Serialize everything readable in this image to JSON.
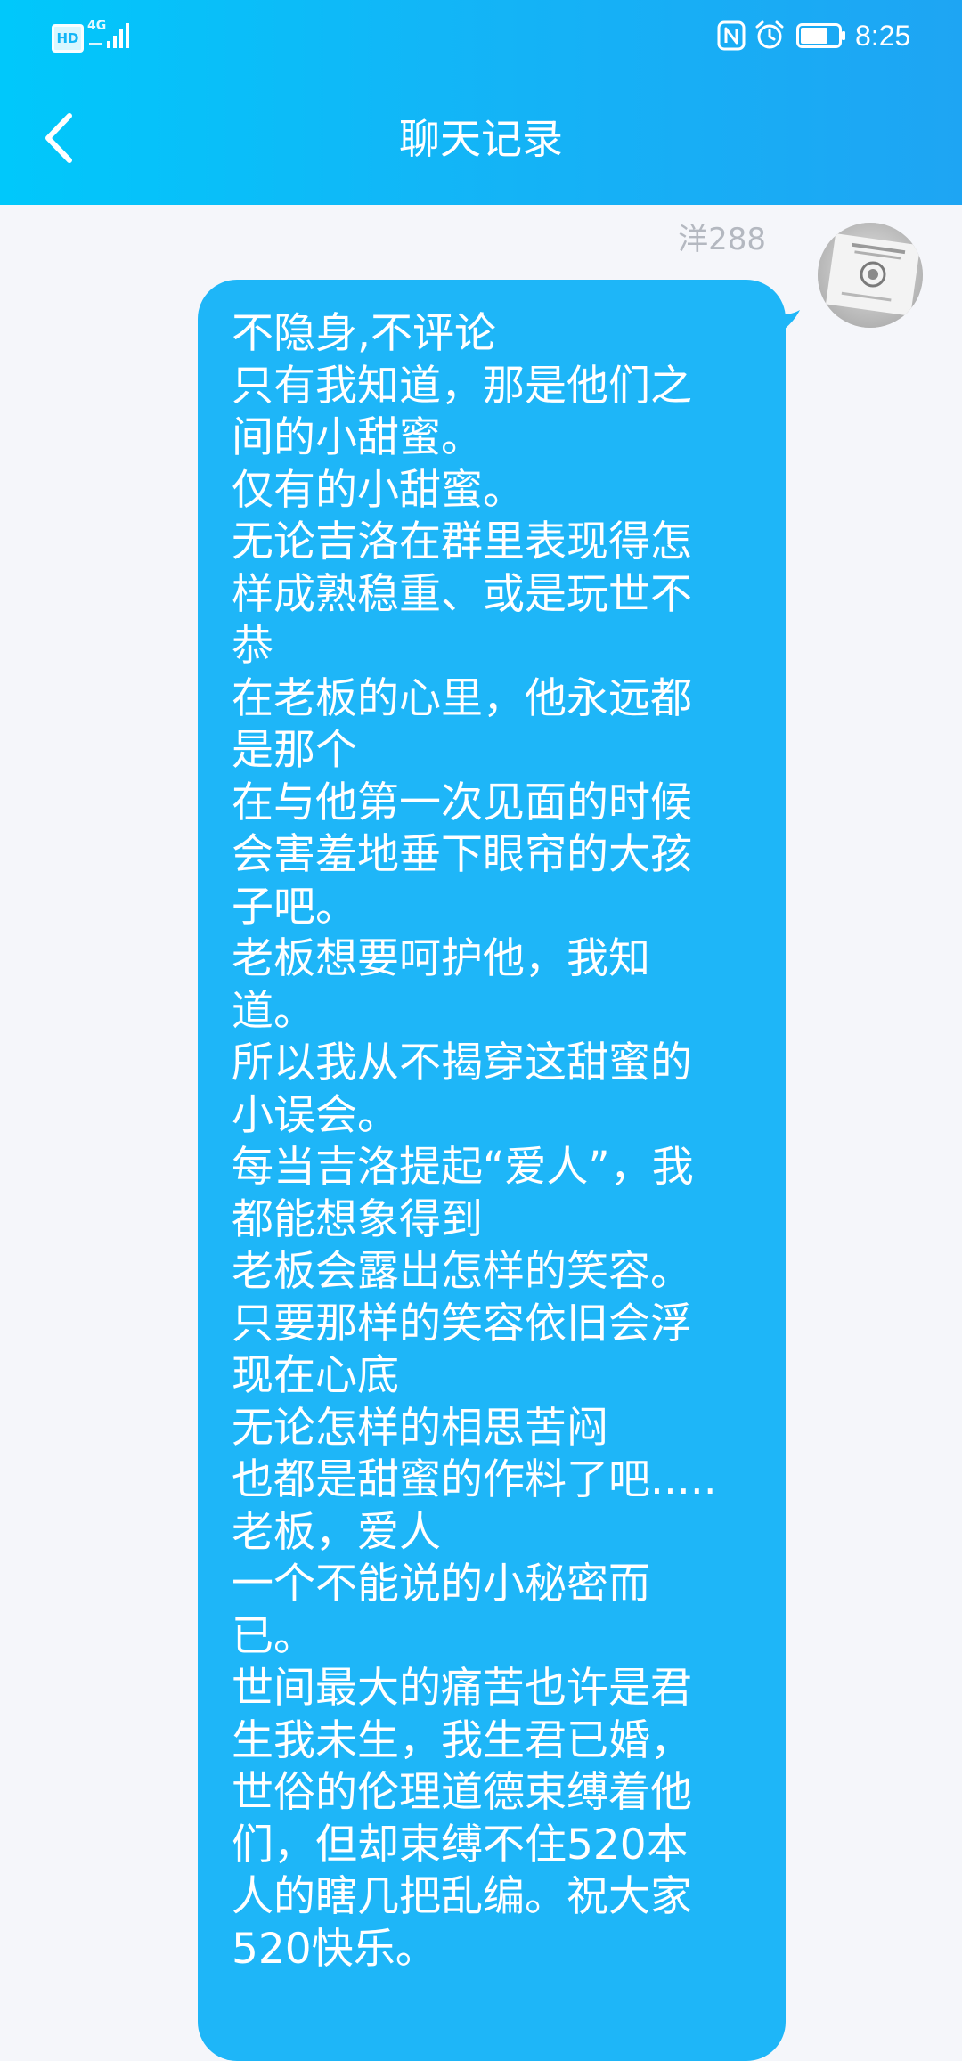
{
  "status_bar": {
    "hd_label": "HD",
    "network_label": "4G",
    "time": "8:25",
    "icons": [
      "hd-icon",
      "signal-4g-icon",
      "nfc-icon",
      "alarm-icon",
      "battery-icon"
    ]
  },
  "header": {
    "title": "聊天记录",
    "back_icon": "chevron-left-icon",
    "gradient_colors": [
      "#00c8fb",
      "#1ea5f3"
    ]
  },
  "message": {
    "sender": "洋288",
    "bubble_color": "#1eb6f8",
    "lines": [
      "不隐身,不评论",
      "只有我知道，那是他们之",
      "间的小甜蜜。",
      "仅有的小甜蜜。",
      "无论吉洛在群里表现得怎",
      "样成熟稳重、或是玩世不",
      "恭",
      "在老板的心里，他永远都",
      "是那个",
      "在与他第一次见面的时候",
      "会害羞地垂下眼帘的大孩",
      "子吧。",
      "老板想要呵护他，我知",
      "道。",
      "所以我从不揭穿这甜蜜的",
      "小误会。",
      "每当吉洛提起“爱人”，我",
      "都能想象得到",
      "老板会露出怎样的笑容。",
      "只要那样的笑容依旧会浮",
      "现在心底",
      "无论怎样的相思苦闷",
      "也都是甜蜜的作料了吧.....",
      "老板，爱人",
      "一个不能说的小秘密而",
      "已。",
      "世间最大的痛苦也许是君",
      "生我未生，我生君已婚，",
      "世俗的伦理道德束缚着他",
      "们，但却束缚不住520本",
      "人的瞎几把乱编。祝大家",
      "520快乐。"
    ]
  }
}
